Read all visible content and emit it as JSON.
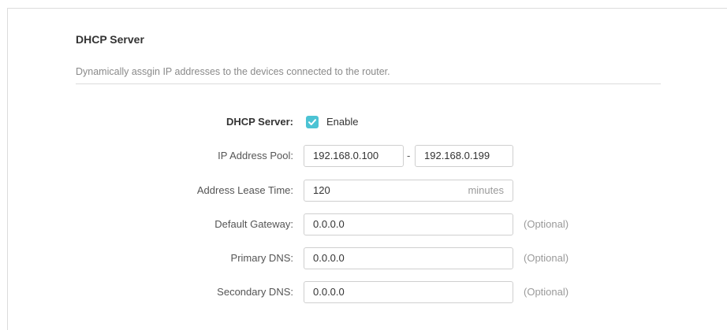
{
  "section": {
    "title": "DHCP Server",
    "description": "Dynamically assgin IP addresses to the devices connected to the router."
  },
  "form": {
    "dhcp_server": {
      "label": "DHCP Server:",
      "checked": true,
      "option_label": "Enable"
    },
    "ip_pool": {
      "label": "IP Address Pool:",
      "start": "192.168.0.100",
      "separator": "-",
      "end": "192.168.0.199"
    },
    "lease_time": {
      "label": "Address Lease Time:",
      "value": "120",
      "unit": "minutes"
    },
    "default_gateway": {
      "label": "Default Gateway:",
      "value": "0.0.0.0",
      "hint": "(Optional)"
    },
    "primary_dns": {
      "label": "Primary DNS:",
      "value": "0.0.0.0",
      "hint": "(Optional)"
    },
    "secondary_dns": {
      "label": "Secondary DNS:",
      "value": "0.0.0.0",
      "hint": "(Optional)"
    }
  },
  "colors": {
    "accent": "#4cc3d4",
    "border": "#cfcfcf",
    "muted_text": "#9a9a9a"
  },
  "icons": {
    "checkbox": "checkmark-icon"
  }
}
